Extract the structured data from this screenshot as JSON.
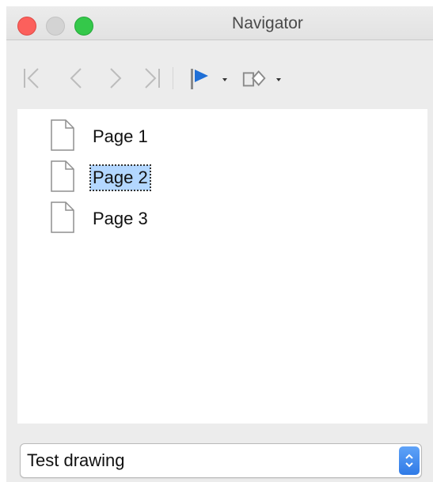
{
  "window": {
    "title": "Navigator"
  },
  "toolbar": {
    "buttons": [
      {
        "name": "first-page",
        "icon": "first-page-icon"
      },
      {
        "name": "previous-page",
        "icon": "previous-page-icon"
      },
      {
        "name": "next-page",
        "icon": "next-page-icon"
      },
      {
        "name": "last-page",
        "icon": "last-page-icon"
      },
      {
        "name": "drag-mode",
        "icon": "flag-icon"
      },
      {
        "name": "shapes",
        "icon": "shapes-icon"
      }
    ]
  },
  "tree": {
    "items": [
      {
        "label": "Page 1",
        "selected": false
      },
      {
        "label": "Page 2",
        "selected": true
      },
      {
        "label": "Page 3",
        "selected": false
      }
    ]
  },
  "document_select": {
    "value": "Test drawing"
  },
  "colors": {
    "selection": "#b3d7ff",
    "flag": "#1f6fd6",
    "stepper": "#2f7ae6"
  }
}
